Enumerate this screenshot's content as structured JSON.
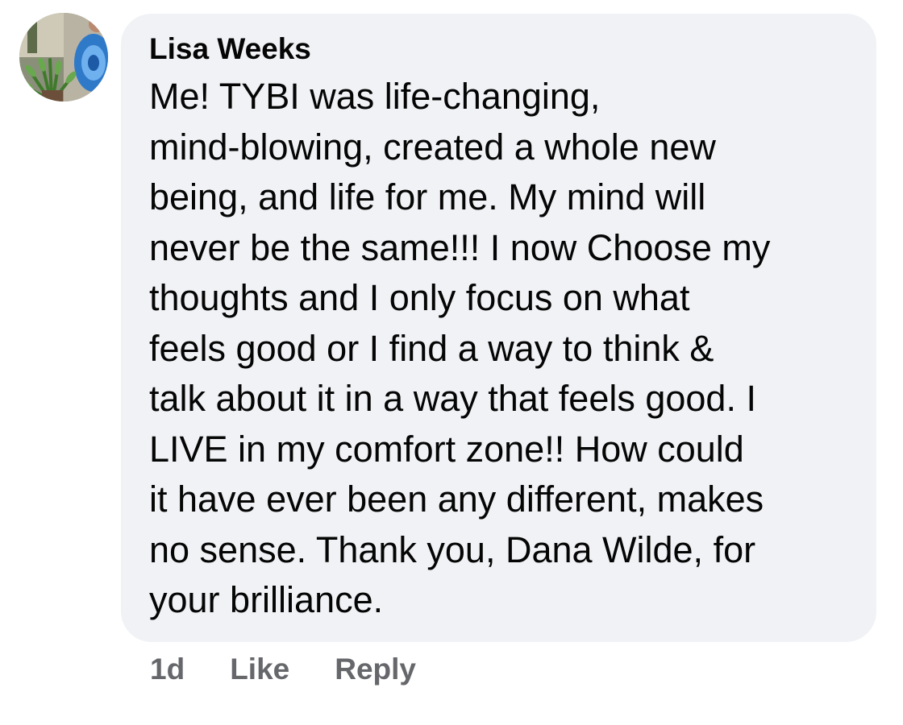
{
  "comment": {
    "author": "Lisa Weeks",
    "lines": [
      "Me!  TYBI was life-changing,",
      "mind-blowing, created a whole new",
      "being, and life for me.  My mind will",
      "never be the same!!!  I now Choose my",
      "thoughts and I only focus on what",
      "feels good or I find a way to think &",
      "talk about it in a way that feels good. I",
      "LIVE in my comfort zone!!  How could",
      "it have ever been any different, makes",
      "no sense. Thank you, Dana Wilde, for",
      "your brilliance."
    ]
  },
  "actions": {
    "time": "1d",
    "like_label": "Like",
    "reply_label": "Reply"
  },
  "colors": {
    "bubble_bg": "#f0f2f5",
    "text": "#050505",
    "meta": "#65676b"
  },
  "icons": {
    "avatar": "profile-photo"
  }
}
